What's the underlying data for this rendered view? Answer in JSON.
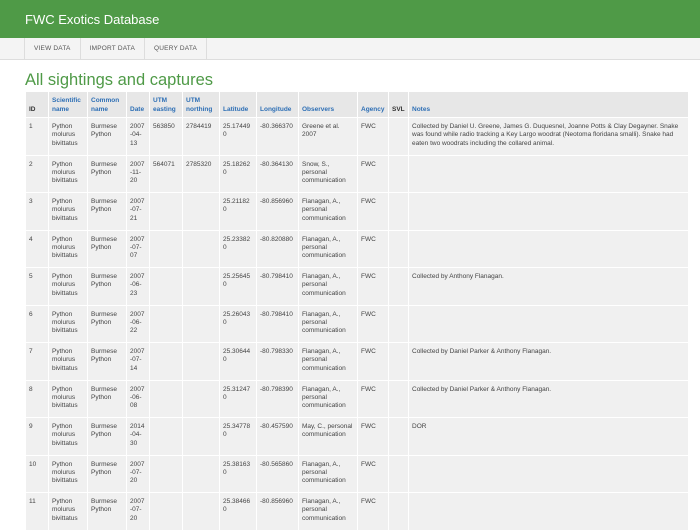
{
  "app": {
    "title": "FWC Exotics Database"
  },
  "nav": {
    "items": [
      "VIEW DATA",
      "IMPORT DATA",
      "QUERY DATA"
    ]
  },
  "page": {
    "title": "All sightings and captures"
  },
  "table": {
    "headers": [
      "ID",
      "Scientific name",
      "Common name",
      "Date",
      "UTM easting",
      "UTM northing",
      "Latitude",
      "Longitude",
      "Observers",
      "Agency",
      "SVL",
      "Notes"
    ],
    "rows": [
      {
        "id": "1",
        "sci": "Python molurus bivittatus",
        "common": "Burmese Python",
        "date": "2007-04-13",
        "easting": "563850",
        "northing": "2784419",
        "lat": "25.174490",
        "lon": "-80.366370",
        "obs": "Greene et al. 2007",
        "agency": "FWC",
        "svl": "",
        "notes": "Collected by Daniel U. Greene, James G. Duquesnel, Joanne Potts & Clay Degayner. Snake was found while radio tracking a Key Largo woodrat (Neotoma floridana smalli). Snake had eaten two woodrats including the collared animal."
      },
      {
        "id": "2",
        "sci": "Python molurus bivittatus",
        "common": "Burmese Python",
        "date": "2007-11-20",
        "easting": "564071",
        "northing": "2785320",
        "lat": "25.182620",
        "lon": "-80.364130",
        "obs": "Snow, S., personal communication",
        "agency": "FWC",
        "svl": "",
        "notes": ""
      },
      {
        "id": "3",
        "sci": "Python molurus bivittatus",
        "common": "Burmese Python",
        "date": "2007-07-21",
        "easting": "",
        "northing": "",
        "lat": "25.211820",
        "lon": "-80.856960",
        "obs": "Flanagan, A., personal communication",
        "agency": "FWC",
        "svl": "",
        "notes": ""
      },
      {
        "id": "4",
        "sci": "Python molurus bivittatus",
        "common": "Burmese Python",
        "date": "2007-07-07",
        "easting": "",
        "northing": "",
        "lat": "25.233820",
        "lon": "-80.820880",
        "obs": "Flanagan, A., personal communication",
        "agency": "FWC",
        "svl": "",
        "notes": ""
      },
      {
        "id": "5",
        "sci": "Python molurus bivittatus",
        "common": "Burmese Python",
        "date": "2007-06-23",
        "easting": "",
        "northing": "",
        "lat": "25.256450",
        "lon": "-80.798410",
        "obs": "Flanagan, A., personal communication",
        "agency": "FWC",
        "svl": "",
        "notes": "Collected by Anthony Flanagan."
      },
      {
        "id": "6",
        "sci": "Python molurus bivittatus",
        "common": "Burmese Python",
        "date": "2007-06-22",
        "easting": "",
        "northing": "",
        "lat": "25.260430",
        "lon": "-80.798410",
        "obs": "Flanagan, A., personal communication",
        "agency": "FWC",
        "svl": "",
        "notes": ""
      },
      {
        "id": "7",
        "sci": "Python molurus bivittatus",
        "common": "Burmese Python",
        "date": "2007-07-14",
        "easting": "",
        "northing": "",
        "lat": "25.306440",
        "lon": "-80.798330",
        "obs": "Flanagan, A., personal communication",
        "agency": "FWC",
        "svl": "",
        "notes": "Collected by Daniel Parker & Anthony Flanagan."
      },
      {
        "id": "8",
        "sci": "Python molurus bivittatus",
        "common": "Burmese Python",
        "date": "2007-06-08",
        "easting": "",
        "northing": "",
        "lat": "25.312470",
        "lon": "-80.798390",
        "obs": "Flanagan, A., personal communication",
        "agency": "FWC",
        "svl": "",
        "notes": "Collected by Daniel Parker & Anthony Flanagan."
      },
      {
        "id": "9",
        "sci": "Python molurus bivittatus",
        "common": "Burmese Python",
        "date": "2014-04-30",
        "easting": "",
        "northing": "",
        "lat": "25.347780",
        "lon": "-80.457590",
        "obs": "May, C., personal communication",
        "agency": "FWC",
        "svl": "",
        "notes": "DOR"
      },
      {
        "id": "10",
        "sci": "Python molurus bivittatus",
        "common": "Burmese Python",
        "date": "2007-07-20",
        "easting": "",
        "northing": "",
        "lat": "25.381630",
        "lon": "-80.565860",
        "obs": "Flanagan, A., personal communication",
        "agency": "FWC",
        "svl": "",
        "notes": ""
      },
      {
        "id": "11",
        "sci": "Python molurus bivittatus",
        "common": "Burmese Python",
        "date": "2007-07-20",
        "easting": "",
        "northing": "",
        "lat": "25.384660",
        "lon": "-80.856960",
        "obs": "Flanagan, A., personal communication",
        "agency": "FWC",
        "svl": "",
        "notes": ""
      }
    ]
  },
  "colors": {
    "header_green": "#4f9a47",
    "link_blue": "#2e6fb5",
    "row_bg": "#f0f0f0"
  }
}
